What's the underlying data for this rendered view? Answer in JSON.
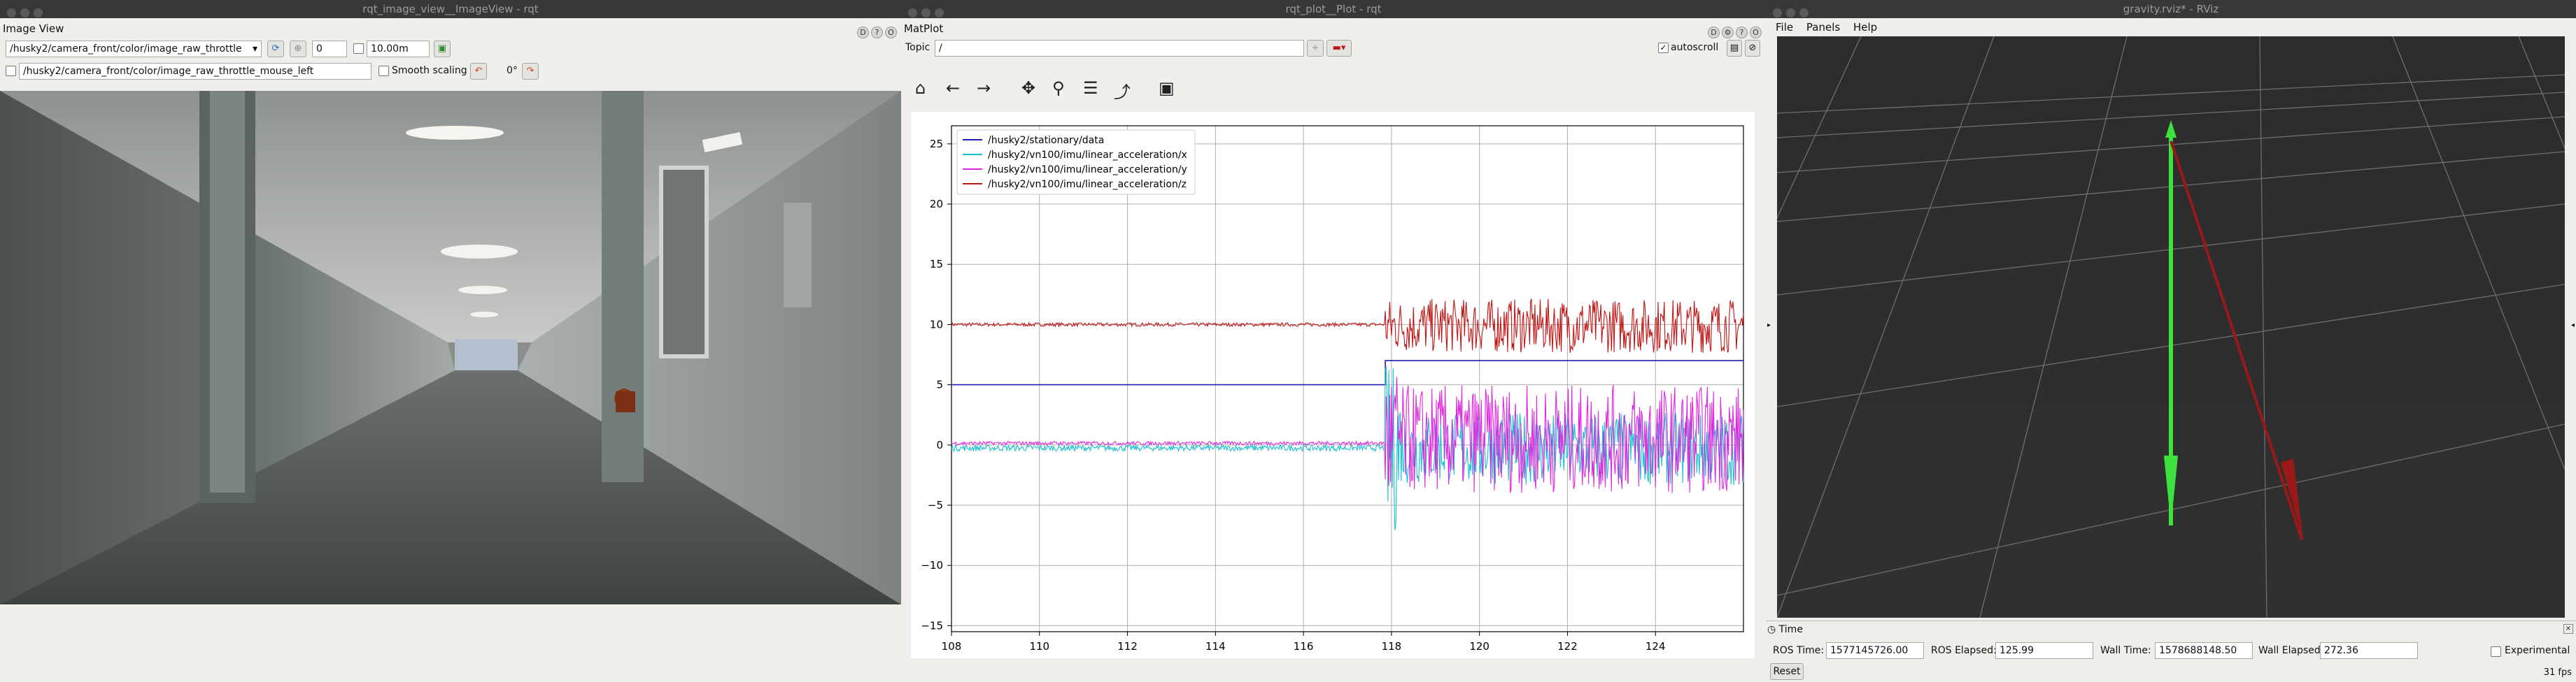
{
  "image_view": {
    "window_title": "rqt_image_view__ImageView - rqt",
    "dock_title": "Image View",
    "topic": "/husky2/camera_front/color/image_raw_throttle",
    "spin_value": "0",
    "max_depth": "10.00m",
    "mouse_topic": "/husky2/camera_front/color/image_raw_throttle_mouse_left",
    "smooth_label": "Smooth scaling",
    "rotation": "0°"
  },
  "plot": {
    "window_title": "rqt_plot__Plot - rqt",
    "dock_title": "MatPlot",
    "topic_label": "Topic",
    "topic_value": "/",
    "autoscroll_label": "autoscroll",
    "toolbar_icons": [
      "home-icon",
      "back-icon",
      "forward-icon",
      "pan-icon",
      "zoom-icon",
      "configure-icon",
      "edit-curve-icon",
      "save-icon"
    ]
  },
  "chart_data": {
    "type": "line",
    "xlim": [
      108,
      126
    ],
    "ylim": [
      -15.5,
      26.5
    ],
    "xticks": [
      "108",
      "110",
      "112",
      "114",
      "116",
      "118",
      "120",
      "122",
      "124"
    ],
    "yticks": [
      "25",
      "20",
      "15",
      "10",
      "5",
      "0",
      "−5",
      "−10",
      "−15"
    ],
    "grid": true,
    "legend_position": "top-left",
    "series": [
      {
        "name": "/husky2/stationary/data",
        "color": "#1f1fb4"
      },
      {
        "name": "/husky2/vn100/imu/linear_acceleration/x",
        "color": "#17becf"
      },
      {
        "name": "/husky2/vn100/imu/linear_acceleration/y",
        "color": "#e026e0"
      },
      {
        "name": "/husky2/vn100/imu/linear_acceleration/z",
        "color": "#c01515"
      }
    ]
  },
  "rviz": {
    "window_title": "gravity.rviz* - RViz",
    "menu": [
      "File",
      "Panels",
      "Help"
    ],
    "time_panel_title": "Time",
    "ros_time_label": "ROS Time:",
    "ros_time": "1577145726.00",
    "ros_elapsed_label": "ROS Elapsed:",
    "ros_elapsed": "125.99",
    "wall_time_label": "Wall Time:",
    "wall_time": "1578688148.50",
    "wall_elapsed_label": "Wall Elapsed:",
    "wall_elapsed": "272.36",
    "experimental_label": "Experimental",
    "reset_label": "Reset",
    "fps": "31 fps"
  }
}
